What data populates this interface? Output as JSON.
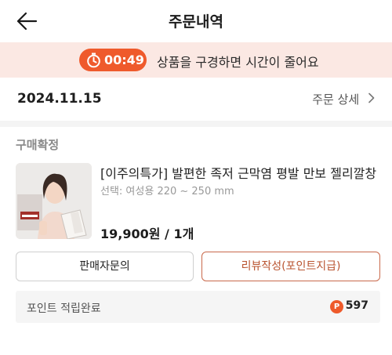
{
  "header": {
    "title": "주문내역",
    "back_icon": "arrow-left-icon"
  },
  "timer_banner": {
    "icon": "stopwatch-icon",
    "time": "00:49",
    "message": "상품을 구경하면 시간이 줄어요",
    "accent_color": "#ef5a2c",
    "background_color": "#fbe8e3"
  },
  "order": {
    "date": "2024.11.15",
    "detail_label": "주문 상세",
    "status": "구매확정",
    "product": {
      "name": "[이주의특가] 발편한 족저 근막염 평발 만보 젤리깔창",
      "option": "선택: 여성용 220 ~ 250 mm",
      "price_qty": "19,900원 / 1개"
    },
    "buttons": {
      "inquiry": "판매자문의",
      "review": "리뷰작성(포인트지급)"
    },
    "points": {
      "label": "포인트 적립완료",
      "badge": "P",
      "value": "597"
    }
  }
}
